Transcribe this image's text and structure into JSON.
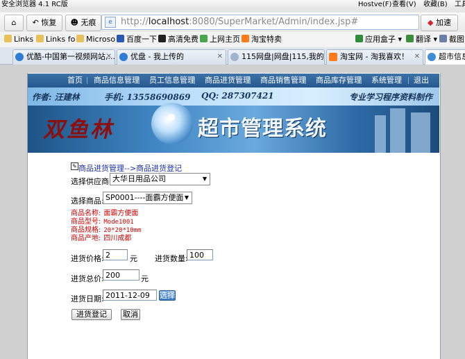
{
  "browser": {
    "title": "安全浏览器 4.1 RC版",
    "menu": [
      "Hostve(F)",
      "查看(V)",
      "收藏(B)",
      "工具"
    ],
    "nav": {
      "back_label": "恢复",
      "traceless_label": "无痕",
      "accelerate_label": "加速"
    },
    "address": {
      "url_gray_prefix": "http://",
      "url_host": "localhost",
      "url_rest": ":8080/SuperMarket/Admin/index.jsp#"
    },
    "bookmarks": [
      "Links",
      "Links fo",
      "Microso",
      "百度一下",
      "高清免费",
      "上网主页",
      "淘宝特卖",
      "应用盒子",
      "翻译",
      "截图"
    ],
    "tabs": [
      {
        "label": "优酷-中国第一视频网站,..."
      },
      {
        "label": "优盘 - 我上传的"
      },
      {
        "label": "115网盘|网盘|115,我的..."
      },
      {
        "label": "淘宝网 - 淘我喜欢！"
      },
      {
        "label": "超市信息"
      }
    ]
  },
  "site": {
    "menu": [
      "首页",
      "商品信息管理",
      "员工信息管理",
      "商品进货管理",
      "商品销售管理",
      "商品库存管理",
      "系统管理",
      "退出"
    ],
    "banner": {
      "author": "作者: 汪建林",
      "phone": "手机: 13558690869",
      "qq": "QQ: 287307421",
      "slogan": "专业学习程序资料制作",
      "brand": "双鱼林",
      "system_title": "超市管理系统"
    }
  },
  "form": {
    "breadcrumb": "商品进货管理-->商品进货登记",
    "supplier_label": "选择供应商:",
    "supplier_value": "大华日用品公司",
    "product_label": "选择商品:",
    "product_value": "SP0001----面霸方便面",
    "product_info": [
      {
        "label": "商品名称:",
        "value": "面霸方便面"
      },
      {
        "label": "商品型号:",
        "value": "Mode1001"
      },
      {
        "label": "商品规格:",
        "value": "20*20*10mm"
      },
      {
        "label": "商品产地:",
        "value": "四川成都"
      }
    ],
    "price_label": "进货价格:",
    "price_value": "2",
    "price_unit": "元",
    "qty_label": "进货数量:",
    "qty_value": "100",
    "total_label": "进货总价:",
    "total_value": "200",
    "total_unit": "元",
    "date_label": "进货日期:",
    "date_value": "2011-12-09",
    "choose_button": "选择",
    "submit_button": "进货登记",
    "cancel_button": "取消"
  }
}
